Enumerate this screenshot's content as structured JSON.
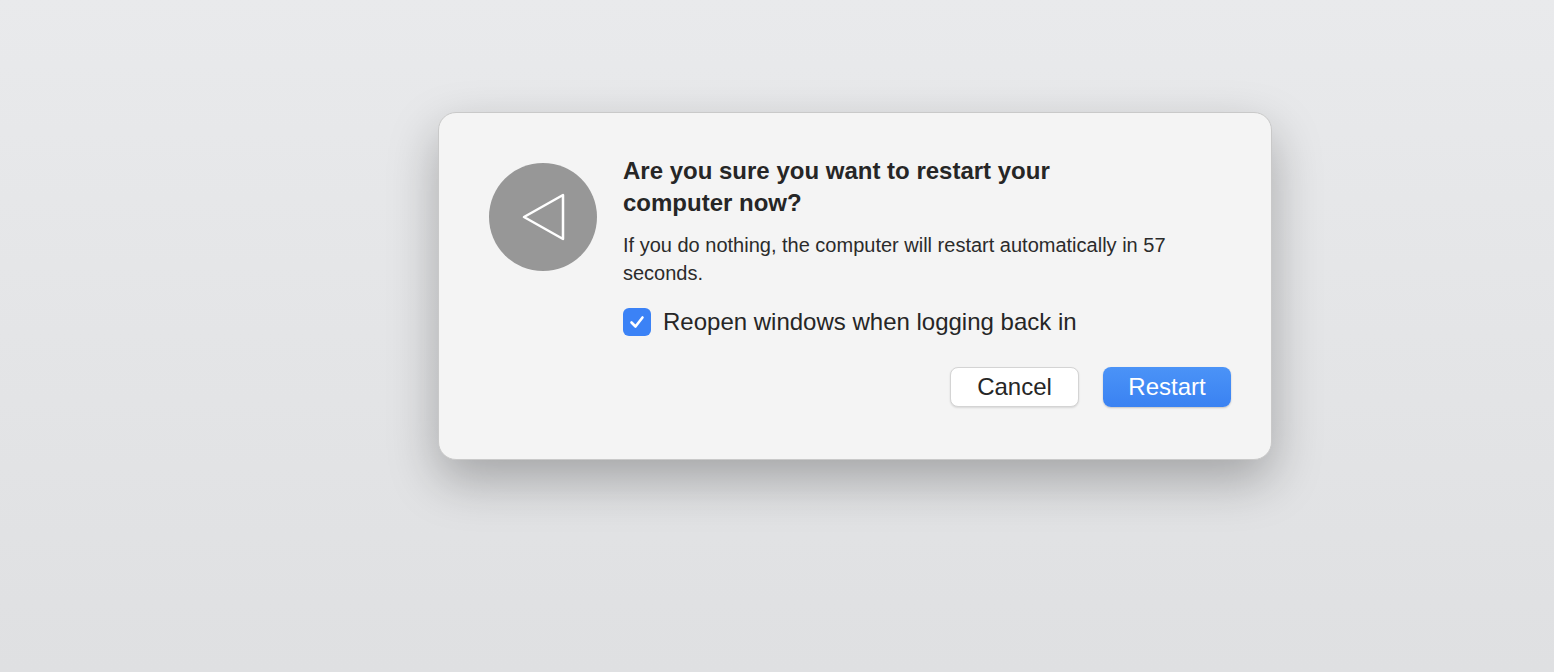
{
  "dialog": {
    "title": "Are you sure you want to restart your computer now?",
    "message": "If you do nothing, the computer will restart automatically in 57 seconds.",
    "checkbox": {
      "label": "Reopen windows when logging back in",
      "checked": true
    },
    "buttons": [
      {
        "label": "Cancel",
        "default": false
      },
      {
        "label": "Restart",
        "default": true
      }
    ]
  }
}
